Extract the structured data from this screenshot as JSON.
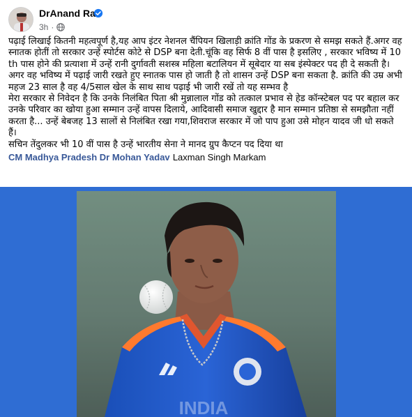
{
  "author": {
    "name": "DrAnand Rai",
    "time": "3h"
  },
  "post": {
    "paragraphs": [
      "पढ़ाई  लिखाई कितनी महत्वपूर्ण है,यह आप इंटर नेशनल चैंपियन खिलाड़ी क्रांति गोंड के प्रकरण से समझ सकते हैं.अगर वह स्नातक होतीं तो सरकार उन्हें स्पोर्टस कोटे से DSP बना देती.चूंकि वह सिर्फ 8 वीं पास है इसलिए , सरकार भविष्य में 10 th पास होने की प्रत्याशा में उन्हें रानी दुर्गावती सशस्त्र महिला बटालियन में सूबेदार या सब इंस्पेक्टर पद ही दे सकती है।",
      "अगर वह भविष्य में पढ़ाई जारी रखते हुए स्नातक पास हो जाती है तो शासन उन्हें DSP बना सकता है. क्रांति की उम्र अभी महज 23 साल है वह 4/5साल खेल के साथ साथ पढ़ाई भी जारी रखें तो यह सम्भव है",
      "मेरा सरकार से निवेदन है कि उनके निलंबित पिता श्री मुन्नालाल गोंड को तत्काल प्रभाव से हेड कॉन्स्टेबल पद पर बहाल कर उनके परिवार का खोया हुआ सम्मान उन्हें वापस दिलाये, आदिवासी समाज खुद्दार है मान सम्मान प्रतिष्ठा से समझौता नहीं करता है... उन्हें बेबजह 13 सालों से निलंबित रखा गया,शिवराज सरकार में जो पाप हुआ उसे मोहन यादव जी धो सकते हैं।",
      "सचिन तेंदुलकर भी 10 वीं पास है उन्हें भारतीय सेना ने मानद ग्रुप कैप्टन पद दिया था"
    ],
    "tag_link": "CM Madhya Pradesh Dr Mohan Yadav",
    "tag_plain": "Laxman Singh Markam"
  },
  "photo": {
    "jersey_text": "INDIA"
  },
  "colors": {
    "link": "#385898",
    "photo_bg": "#2f6dd3",
    "jersey": "#1f57c9",
    "verified": "#1877f2"
  },
  "icons": {
    "verified": "verified-badge-icon",
    "audience": "globe-icon"
  }
}
